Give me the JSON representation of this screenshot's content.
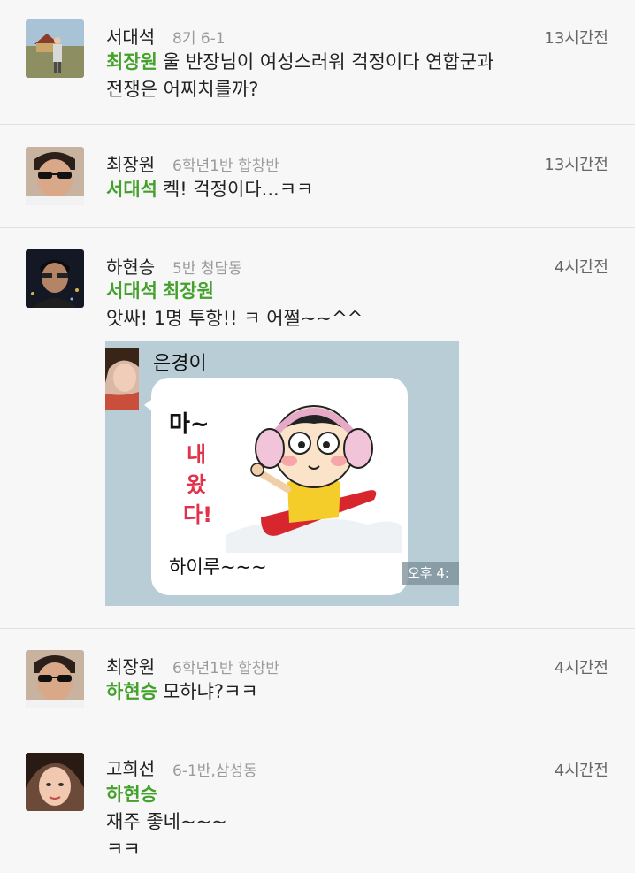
{
  "feed": [
    {
      "author": "서대석",
      "group": "8기 6-1",
      "time": "13시간전",
      "mentions": [
        "최장원"
      ],
      "line1": "울 반장님이 여성스러워 걱정이다 연합군과",
      "line2": "전쟁은 어찌치를까?"
    },
    {
      "author": "최장원",
      "group": "6학년1반 합창반",
      "time": "13시간전",
      "mentions": [
        "서대석"
      ],
      "line1": "켁! 걱정이다...ㅋㅋ"
    },
    {
      "author": "하현승",
      "group": "5반 청담동",
      "time": "4시간전",
      "mentions": [
        "서대석",
        "최장원"
      ],
      "line1": "앗싸! 1명 투항!! ㅋ 어쩔~~^^",
      "attachment": {
        "sender": "은경이",
        "sticker_title": "마~",
        "sticker_chars": [
          "내",
          "왔",
          "다!"
        ],
        "caption": "하이루~~~",
        "timestamp": "오후 4:"
      }
    },
    {
      "author": "최장원",
      "group": "6학년1반 합창반",
      "time": "4시간전",
      "mentions": [
        "하현승"
      ],
      "line1": "모하냐?ㅋㅋ"
    },
    {
      "author": "고희선",
      "group": "6-1반,삼성동",
      "time": "4시간전",
      "mentions": [
        "하현승"
      ],
      "line1": "재주 좋네~~~",
      "line2": "ㅋㅋ"
    }
  ],
  "colors": {
    "mention": "#44a22c",
    "background": "#f7f7f7",
    "divider": "#e2e2e2"
  }
}
